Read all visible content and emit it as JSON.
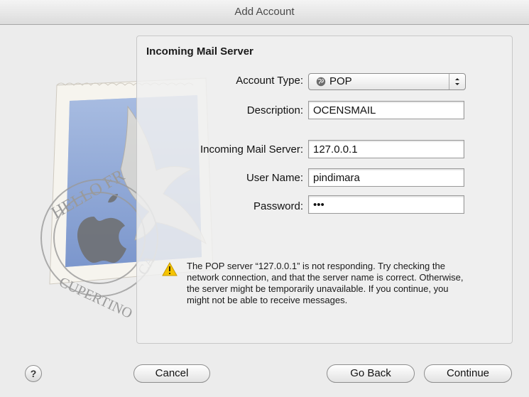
{
  "window": {
    "title": "Add Account"
  },
  "background_stamp": {
    "ring_text_top": "HELLO FR",
    "ring_text_bottom": "CUPERTINO",
    "ring_text_suffix": "CA"
  },
  "section": {
    "title": "Incoming Mail Server"
  },
  "form": {
    "account_type": {
      "label": "Account Type:",
      "value": "POP",
      "icon": "globe-icon"
    },
    "description": {
      "label": "Description:",
      "value": "OCENSMAIL"
    },
    "incoming_server": {
      "label": "Incoming Mail Server:",
      "value": "127.0.0.1"
    },
    "user_name": {
      "label": "User Name:",
      "value": "pindimara"
    },
    "password": {
      "label": "Password:",
      "value": "•••"
    }
  },
  "warning": {
    "icon": "warning-icon",
    "text": "The POP server “127.0.0.1” is not responding. Try checking the network connection, and that the server name is correct. Otherwise, the server might be temporarily unavailable. If you continue, you might not be able to receive messages."
  },
  "buttons": {
    "help": "?",
    "cancel": "Cancel",
    "go_back": "Go Back",
    "continue": "Continue"
  },
  "colors": {
    "window_bg": "#ececec",
    "warning_yellow": "#f5c400"
  }
}
